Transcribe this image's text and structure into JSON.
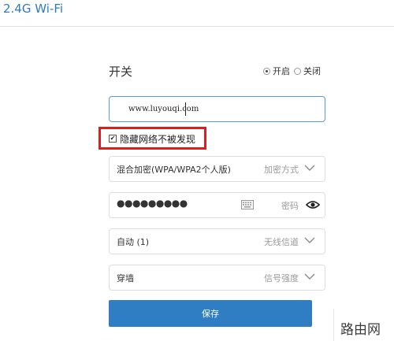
{
  "section": {
    "title": "2.4G Wi-Fi"
  },
  "switch": {
    "label": "开关",
    "options": [
      {
        "label": "开启",
        "selected": true
      },
      {
        "label": "关闭",
        "selected": false
      }
    ]
  },
  "ssid": {
    "value": "www.luyouqi.com"
  },
  "hide_network": {
    "label": "隐藏网络不被发现",
    "checked": true
  },
  "encryption": {
    "value": "混合加密(WPA/WPA2个人版)",
    "hint": "加密方式"
  },
  "password": {
    "dots": "●●●●●●●●●",
    "hint": "密码"
  },
  "channel": {
    "value": "自动 (1)",
    "hint": "无线信道"
  },
  "signal": {
    "value": "穿墙",
    "hint": "信号强度"
  },
  "save": {
    "label": "保存"
  },
  "watermark": {
    "text": "路由网"
  },
  "colors": {
    "accent": "#2f7ec3",
    "title": "#2e7bbf",
    "highlight": "#e31b1b"
  }
}
